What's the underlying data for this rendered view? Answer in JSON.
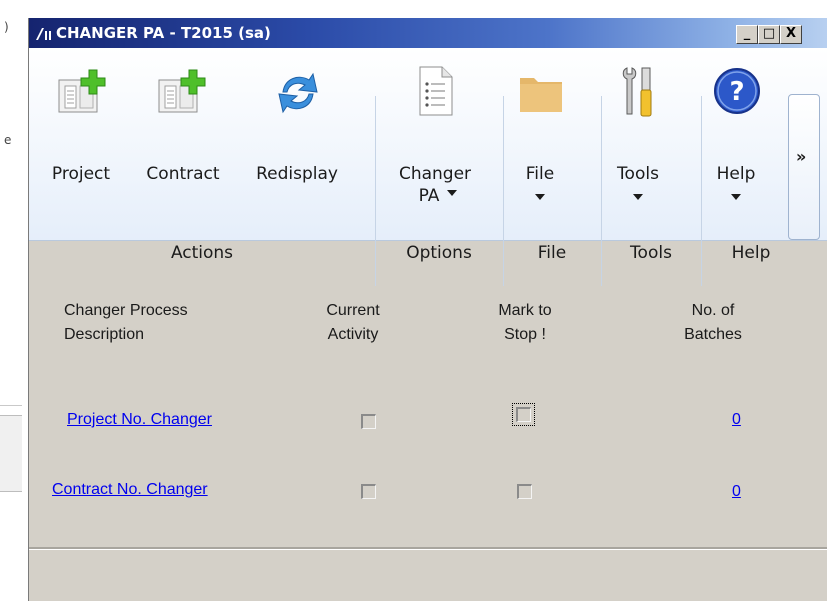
{
  "window": {
    "title": "CHANGER PA  -  T2015 (sa)",
    "controls": {
      "minimize": "_",
      "maximize": "□",
      "close": "X"
    }
  },
  "ribbon": {
    "buttons": [
      {
        "label": "Project",
        "icon": "new-project-icon"
      },
      {
        "label": "Contract",
        "icon": "new-contract-icon"
      },
      {
        "label": "Redisplay",
        "icon": "refresh-icon"
      },
      {
        "label": "Changer",
        "label2": "PA",
        "icon": "document-list-icon"
      },
      {
        "label": "File",
        "icon": "folder-icon"
      },
      {
        "label": "Tools",
        "icon": "tools-icon"
      },
      {
        "label": "Help",
        "icon": "help-icon"
      }
    ],
    "groups": [
      "Actions",
      "Options",
      "File",
      "Tools",
      "Help"
    ],
    "overflow": "»"
  },
  "table": {
    "headers": {
      "description": [
        "Changer Process",
        "Description"
      ],
      "activity": [
        "Current",
        "Activity"
      ],
      "stop": [
        "Mark to",
        "Stop !"
      ],
      "batches": [
        "No. of",
        "Batches"
      ]
    },
    "rows": [
      {
        "description": "Project No. Changer",
        "current_activity": false,
        "mark_to_stop": false,
        "batches": "0"
      },
      {
        "description": "Contract No. Changer",
        "current_activity": false,
        "mark_to_stop": false,
        "batches": "0"
      }
    ]
  },
  "background": {
    "mark1": ")",
    "mark2": "e"
  },
  "colors": {
    "title_start": "#15246f",
    "title_end": "#b8d0f0",
    "form_bg": "#d4d0c8",
    "link": "#0000ee"
  }
}
